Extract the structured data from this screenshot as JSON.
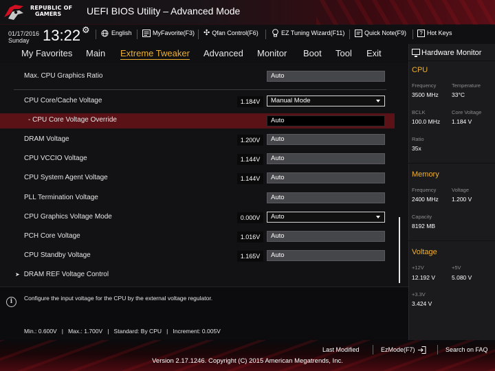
{
  "header": {
    "brand_line1": "REPUBLIC OF",
    "brand_line2": "GAMERS",
    "app_title": "UEFI BIOS Utility – Advanced Mode"
  },
  "infobar": {
    "date": "01/17/2016",
    "day": "Sunday",
    "time": "13:22",
    "items": {
      "language": "English",
      "my_favorite": "MyFavorite(F3)",
      "qfan": "Qfan Control(F6)",
      "ez_tuning": "EZ Tuning Wizard(F11)",
      "quick_note": "Quick Note(F9)",
      "hot_keys": "Hot Keys"
    }
  },
  "tabs": [
    "My Favorites",
    "Main",
    "Extreme Tweaker",
    "Advanced",
    "Monitor",
    "Boot",
    "Tool",
    "Exit"
  ],
  "active_tab": "Extreme Tweaker",
  "settings": {
    "max_cpu_graphics_ratio": {
      "label": "Max. CPU Graphics Ratio",
      "value": "Auto"
    },
    "cpu_core_cache_voltage": {
      "label": "CPU Core/Cache Voltage",
      "current": "1.184V",
      "value": "Manual Mode"
    },
    "cpu_core_voltage_override": {
      "label": "- CPU Core Voltage Override",
      "value": "Auto"
    },
    "dram_voltage": {
      "label": "DRAM Voltage",
      "current": "1.200V",
      "value": "Auto"
    },
    "cpu_vccio_voltage": {
      "label": "CPU VCCIO Voltage",
      "current": "1.144V",
      "value": "Auto"
    },
    "cpu_system_agent_voltage": {
      "label": "CPU System Agent Voltage",
      "current": "1.144V",
      "value": "Auto"
    },
    "pll_termination_voltage": {
      "label": "PLL Termination Voltage",
      "value": "Auto"
    },
    "cpu_graphics_voltage_mode": {
      "label": "CPU Graphics Voltage Mode",
      "current": "0.000V",
      "value": "Auto"
    },
    "pch_core_voltage": {
      "label": "PCH Core Voltage",
      "current": "1.016V",
      "value": "Auto"
    },
    "cpu_standby_voltage": {
      "label": "CPU Standby Voltage",
      "current": "1.165V",
      "value": "Auto"
    },
    "dram_ref_voltage_control": {
      "label": "DRAM REF Voltage Control"
    }
  },
  "help": {
    "description": "Configure the input voltage for the CPU by the external voltage regulator.",
    "range": "Min.: 0.600V   |   Max.: 1.700V   |   Standard: By CPU   |   Increment: 0.005V"
  },
  "hardware_monitor": {
    "title": "Hardware Monitor",
    "cpu": {
      "section": "CPU",
      "frequency_label": "Frequency",
      "frequency": "3500 MHz",
      "temperature_label": "Temperature",
      "temperature": "33°C",
      "bclk_label": "BCLK",
      "bclk": "100.0 MHz",
      "core_voltage_label": "Core Voltage",
      "core_voltage": "1.184 V",
      "ratio_label": "Ratio",
      "ratio": "35x"
    },
    "memory": {
      "section": "Memory",
      "frequency_label": "Frequency",
      "frequency": "2400 MHz",
      "voltage_label": "Voltage",
      "voltage": "1.200 V",
      "capacity_label": "Capacity",
      "capacity": "8192 MB"
    },
    "voltage": {
      "section": "Voltage",
      "v12_label": "+12V",
      "v12": "12.192 V",
      "v5_label": "+5V",
      "v5": "5.080 V",
      "v33_label": "+3.3V",
      "v33": "3.424 V"
    }
  },
  "footer": {
    "last_modified": "Last Modified",
    "ezmode": "EzMode(F7)",
    "search_faq": "Search on FAQ",
    "version": "Version 2.17.1246. Copyright (C) 2015 American Megatrends, Inc."
  },
  "colors": {
    "accent": "#f0b030",
    "highlight": "#5a1216",
    "brand_red": "#c8141e"
  }
}
